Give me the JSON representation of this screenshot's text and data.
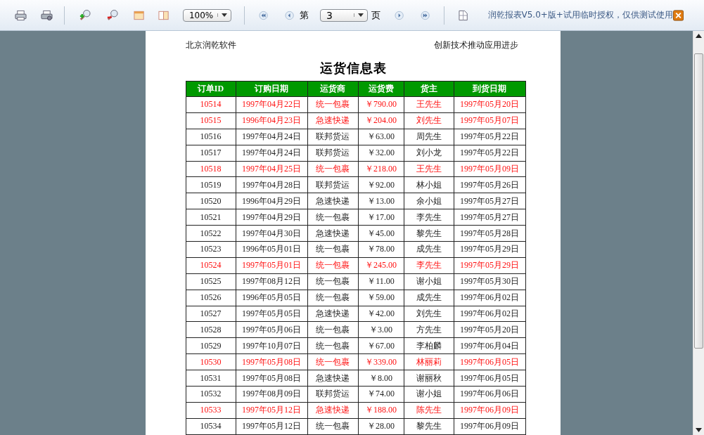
{
  "toolbar": {
    "zoom": "100%",
    "page_prefix": "第",
    "page": "3",
    "page_suffix": "页",
    "license": "润乾报表V5.0+版+试用临时授权，仅供测试使用"
  },
  "report": {
    "company": "北京润乾软件",
    "slogan": "创新技术推动应用进步",
    "title": "运货信息表",
    "columns": [
      "订单ID",
      "订购日期",
      "运货商",
      "运货费",
      "货主",
      "到货日期"
    ],
    "rows": [
      {
        "highlighted": true,
        "cells": [
          "10514",
          "1997年04月22日",
          "统一包裹",
          "￥790.00",
          "王先生",
          "1997年05月20日"
        ]
      },
      {
        "highlighted": true,
        "cells": [
          "10515",
          "1996年04月23日",
          "急速快递",
          "￥204.00",
          "刘先生",
          "1997年05月07日"
        ]
      },
      {
        "highlighted": false,
        "cells": [
          "10516",
          "1997年04月24日",
          "联邦货运",
          "￥63.00",
          "周先生",
          "1997年05月22日"
        ]
      },
      {
        "highlighted": false,
        "cells": [
          "10517",
          "1997年04月24日",
          "联邦货运",
          "￥32.00",
          "刘小龙",
          "1997年05月22日"
        ]
      },
      {
        "highlighted": true,
        "cells": [
          "10518",
          "1997年04月25日",
          "统一包裹",
          "￥218.00",
          "王先生",
          "1997年05月09日"
        ]
      },
      {
        "highlighted": false,
        "cells": [
          "10519",
          "1997年04月28日",
          "联邦货运",
          "￥92.00",
          "林小姐",
          "1997年05月26日"
        ]
      },
      {
        "highlighted": false,
        "cells": [
          "10520",
          "1996年04月29日",
          "急速快递",
          "￥13.00",
          "余小姐",
          "1997年05月27日"
        ]
      },
      {
        "highlighted": false,
        "cells": [
          "10521",
          "1997年04月29日",
          "统一包裹",
          "￥17.00",
          "李先生",
          "1997年05月27日"
        ]
      },
      {
        "highlighted": false,
        "cells": [
          "10522",
          "1997年04月30日",
          "急速快递",
          "￥45.00",
          "黎先生",
          "1997年05月28日"
        ]
      },
      {
        "highlighted": false,
        "cells": [
          "10523",
          "1996年05月01日",
          "统一包裹",
          "￥78.00",
          "成先生",
          "1997年05月29日"
        ]
      },
      {
        "highlighted": true,
        "cells": [
          "10524",
          "1997年05月01日",
          "统一包裹",
          "￥245.00",
          "李先生",
          "1997年05月29日"
        ]
      },
      {
        "highlighted": false,
        "cells": [
          "10525",
          "1997年08月12日",
          "统一包裹",
          "￥11.00",
          "谢小姐",
          "1997年05月30日"
        ]
      },
      {
        "highlighted": false,
        "cells": [
          "10526",
          "1996年05月05日",
          "统一包裹",
          "￥59.00",
          "成先生",
          "1997年06月02日"
        ]
      },
      {
        "highlighted": false,
        "cells": [
          "10527",
          "1997年05月05日",
          "急速快递",
          "￥42.00",
          "刘先生",
          "1997年06月02日"
        ]
      },
      {
        "highlighted": false,
        "cells": [
          "10528",
          "1997年05月06日",
          "统一包裹",
          "￥3.00",
          "方先生",
          "1997年05月20日"
        ]
      },
      {
        "highlighted": false,
        "cells": [
          "10529",
          "1997年10月07日",
          "统一包裹",
          "￥67.00",
          "李柏麟",
          "1997年06月04日"
        ]
      },
      {
        "highlighted": true,
        "cells": [
          "10530",
          "1997年05月08日",
          "统一包裹",
          "￥339.00",
          "林丽莉",
          "1997年06月05日"
        ]
      },
      {
        "highlighted": false,
        "cells": [
          "10531",
          "1997年05月08日",
          "急速快递",
          "￥8.00",
          "谢丽秋",
          "1997年06月05日"
        ]
      },
      {
        "highlighted": false,
        "cells": [
          "10532",
          "1997年08月09日",
          "联邦货运",
          "￥74.00",
          "谢小姐",
          "1997年06月06日"
        ]
      },
      {
        "highlighted": true,
        "cells": [
          "10533",
          "1997年05月12日",
          "急速快递",
          "￥188.00",
          "陈先生",
          "1997年06月09日"
        ]
      },
      {
        "highlighted": false,
        "cells": [
          "10534",
          "1997年05月12日",
          "统一包裹",
          "￥28.00",
          "黎先生",
          "1997年06月09日"
        ]
      }
    ]
  }
}
